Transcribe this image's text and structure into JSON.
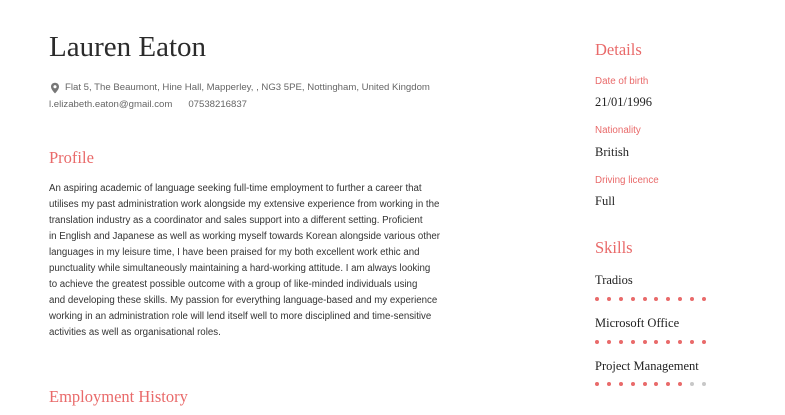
{
  "name": "Lauren Eaton",
  "contact": {
    "address": "Flat 5, The Beaumont, Hine Hall, Mapperley, , NG3 5PE, Nottingham, United Kingdom",
    "email": "l.elizabeth.eaton@gmail.com",
    "phone": "07538216837",
    "address_icon": "location-pin-icon"
  },
  "profile": {
    "heading": "Profile",
    "lines": [
      "An aspiring academic of language seeking full-time employment to further a career that",
      "utilises my past administration work alongside my extensive experience from working in the",
      "translation industry as a coordinator and sales support into a different setting. Proficient",
      "in English and Japanese as well as working myself towards Korean alongside various other",
      "languages in my leisure time, I have been praised for my both excellent work ethic and",
      "punctuality while simultaneously maintaining a hard-working attitude. I am always looking",
      "to achieve the greatest possible outcome with a group of like-minded individuals using",
      "and developing these skills. My passion for everything language-based and my experience",
      "working in an administration role will lend itself well to more disciplined and time-sensitive",
      "activities as well as organisational roles."
    ]
  },
  "employment": {
    "heading": "Employment History"
  },
  "details": {
    "heading": "Details",
    "date_of_birth_label": "Date of birth",
    "date_of_birth": "21/01/1996",
    "nationality_label": "Nationality",
    "nationality": "British",
    "driving_licence_label": "Driving licence",
    "driving_licence": "Full"
  },
  "skills": {
    "heading": "Skills",
    "items": [
      {
        "name": "Tradios",
        "level": 10,
        "max": 10
      },
      {
        "name": "Microsoft Office",
        "level": 10,
        "max": 10
      },
      {
        "name": "Project Management",
        "level": 8,
        "max": 10
      }
    ]
  },
  "colors": {
    "accent": "#e96a6a",
    "text": "#333333",
    "muted": "#666666",
    "dot_inactive": "#c8c8c8"
  }
}
